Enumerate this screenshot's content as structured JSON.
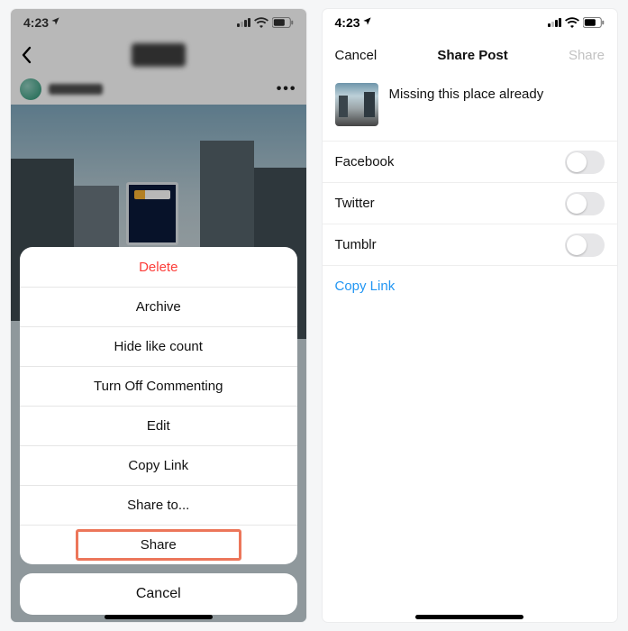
{
  "status": {
    "time": "4:23",
    "nav_glyph": "✈"
  },
  "left_screen": {
    "actions": {
      "delete": "Delete",
      "archive": "Archive",
      "hide_likes": "Hide like count",
      "turn_off_comments": "Turn Off Commenting",
      "edit": "Edit",
      "copy_link": "Copy Link",
      "share_to": "Share to...",
      "share": "Share"
    },
    "cancel": "Cancel"
  },
  "right_screen": {
    "nav": {
      "cancel": "Cancel",
      "title": "Share Post",
      "share": "Share"
    },
    "caption": "Missing this place already",
    "options": {
      "facebook": "Facebook",
      "twitter": "Twitter",
      "tumblr": "Tumblr"
    },
    "copy_link": "Copy Link"
  },
  "colors": {
    "destructive": "#fc3d39",
    "highlight_border": "#ec765a",
    "link": "#2196f3"
  }
}
